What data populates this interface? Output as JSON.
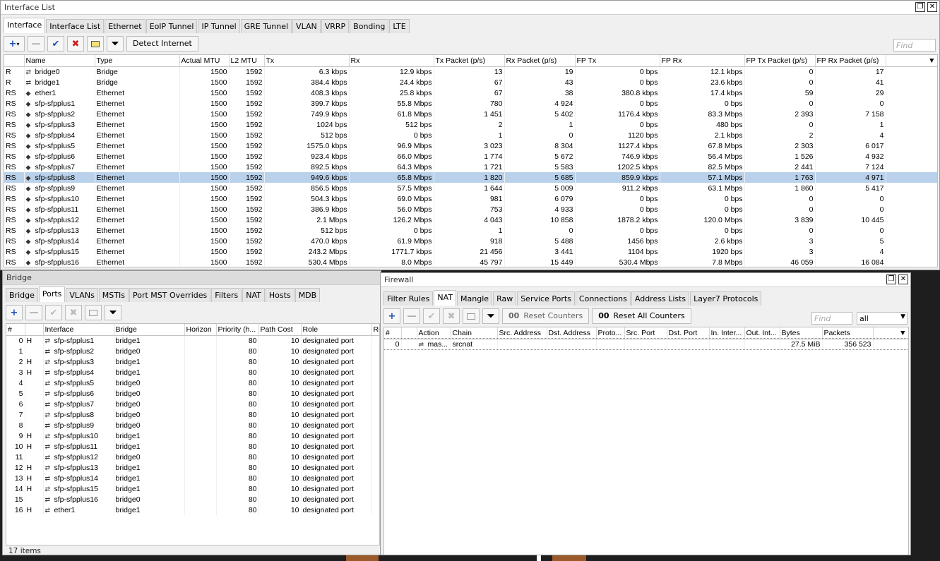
{
  "iface": {
    "title": "Interface List",
    "tabs": [
      "Interface",
      "Interface List",
      "Ethernet",
      "EoIP Tunnel",
      "IP Tunnel",
      "GRE Tunnel",
      "VLAN",
      "VRRP",
      "Bonding",
      "LTE"
    ],
    "detect_label": "Detect Internet",
    "find_placeholder": "Find",
    "columns": [
      "Name",
      "Type",
      "Actual MTU",
      "L2 MTU",
      "Tx",
      "Rx",
      "Tx Packet (p/s)",
      "Rx Packet (p/s)",
      "FP Tx",
      "FP Rx",
      "FP Tx Packet (p/s)",
      "FP Rx Packet (p/s)"
    ],
    "rows": [
      [
        "R",
        "bridge0",
        "Bridge",
        "1500",
        "1592",
        "6.3 kbps",
        "12.9 kbps",
        "13",
        "19",
        "0 bps",
        "12.1 kbps",
        "0",
        "17"
      ],
      [
        "R",
        "bridge1",
        "Bridge",
        "1500",
        "1592",
        "384.4 kbps",
        "24.4 kbps",
        "67",
        "43",
        "0 bps",
        "23.6 kbps",
        "0",
        "41"
      ],
      [
        "RS",
        "ether1",
        "Ethernet",
        "1500",
        "1592",
        "408.3 kbps",
        "25.8 kbps",
        "67",
        "38",
        "380.8 kbps",
        "17.4 kbps",
        "59",
        "29"
      ],
      [
        "RS",
        "sfp-sfpplus1",
        "Ethernet",
        "1500",
        "1592",
        "399.7 kbps",
        "55.8 Mbps",
        "780",
        "4 924",
        "0 bps",
        "0 bps",
        "0",
        "0"
      ],
      [
        "RS",
        "sfp-sfpplus2",
        "Ethernet",
        "1500",
        "1592",
        "749.9 kbps",
        "61.8 Mbps",
        "1 451",
        "5 402",
        "1176.4 kbps",
        "83.3 Mbps",
        "2 393",
        "7 158"
      ],
      [
        "RS",
        "sfp-sfpplus3",
        "Ethernet",
        "1500",
        "1592",
        "1024 bps",
        "512 bps",
        "2",
        "1",
        "0 bps",
        "480 bps",
        "0",
        "1"
      ],
      [
        "RS",
        "sfp-sfpplus4",
        "Ethernet",
        "1500",
        "1592",
        "512 bps",
        "0 bps",
        "1",
        "0",
        "1120 bps",
        "2.1 kbps",
        "2",
        "4"
      ],
      [
        "RS",
        "sfp-sfpplus5",
        "Ethernet",
        "1500",
        "1592",
        "1575.0 kbps",
        "96.9 Mbps",
        "3 023",
        "8 304",
        "1127.4 kbps",
        "67.8 Mbps",
        "2 303",
        "6 017"
      ],
      [
        "RS",
        "sfp-sfpplus6",
        "Ethernet",
        "1500",
        "1592",
        "923.4 kbps",
        "66.0 Mbps",
        "1 774",
        "5 672",
        "746.9 kbps",
        "56.4 Mbps",
        "1 526",
        "4 932"
      ],
      [
        "RS",
        "sfp-sfpplus7",
        "Ethernet",
        "1500",
        "1592",
        "892.5 kbps",
        "64.3 Mbps",
        "1 721",
        "5 583",
        "1202.5 kbps",
        "82.5 Mbps",
        "2 441",
        "7 124"
      ],
      [
        "RS",
        "sfp-sfpplus8",
        "Ethernet",
        "1500",
        "1592",
        "949.6 kbps",
        "65.8 Mbps",
        "1 820",
        "5 685",
        "859.9 kbps",
        "57.1 Mbps",
        "1 763",
        "4 971"
      ],
      [
        "RS",
        "sfp-sfpplus9",
        "Ethernet",
        "1500",
        "1592",
        "856.5 kbps",
        "57.5 Mbps",
        "1 644",
        "5 009",
        "911.2 kbps",
        "63.1 Mbps",
        "1 860",
        "5 417"
      ],
      [
        "RS",
        "sfp-sfpplus10",
        "Ethernet",
        "1500",
        "1592",
        "504.3 kbps",
        "69.0 Mbps",
        "981",
        "6 079",
        "0 bps",
        "0 bps",
        "0",
        "0"
      ],
      [
        "RS",
        "sfp-sfpplus11",
        "Ethernet",
        "1500",
        "1592",
        "386.9 kbps",
        "56.0 Mbps",
        "753",
        "4 933",
        "0 bps",
        "0 bps",
        "0",
        "0"
      ],
      [
        "RS",
        "sfp-sfpplus12",
        "Ethernet",
        "1500",
        "1592",
        "2.1 Mbps",
        "126.2 Mbps",
        "4 043",
        "10 858",
        "1878.2 kbps",
        "120.0 Mbps",
        "3 839",
        "10 445"
      ],
      [
        "RS",
        "sfp-sfpplus13",
        "Ethernet",
        "1500",
        "1592",
        "512 bps",
        "0 bps",
        "1",
        "0",
        "0 bps",
        "0 bps",
        "0",
        "0"
      ],
      [
        "RS",
        "sfp-sfpplus14",
        "Ethernet",
        "1500",
        "1592",
        "470.0 kbps",
        "61.9 Mbps",
        "918",
        "5 488",
        "1456 bps",
        "2.6 kbps",
        "3",
        "5"
      ],
      [
        "RS",
        "sfp-sfpplus15",
        "Ethernet",
        "1500",
        "1592",
        "243.2 Mbps",
        "1771.7 kbps",
        "21 456",
        "3 441",
        "1104 bps",
        "1920 bps",
        "3",
        "4"
      ],
      [
        "RS",
        "sfp-sfpplus16",
        "Ethernet",
        "1500",
        "1592",
        "530.4 Mbps",
        "8.0 Mbps",
        "45 797",
        "15 449",
        "530.4 Mbps",
        "7.8 Mbps",
        "46 059",
        "16 084"
      ]
    ],
    "selected_row": 10
  },
  "bridge": {
    "title": "Bridge",
    "tabs": [
      "Bridge",
      "Ports",
      "VLANs",
      "MSTIs",
      "Port MST Overrides",
      "Filters",
      "NAT",
      "Hosts",
      "MDB"
    ],
    "columns": [
      "#",
      "Interface",
      "Bridge",
      "Horizon",
      "Priority (h...",
      "Path Cost",
      "Role",
      "Ro"
    ],
    "rows": [
      [
        "0",
        "H",
        "sfp-sfpplus1",
        "bridge1",
        "",
        "80",
        "10",
        "designated port"
      ],
      [
        "1",
        "",
        "sfp-sfpplus2",
        "bridge0",
        "",
        "80",
        "10",
        "designated port"
      ],
      [
        "2",
        "H",
        "sfp-sfpplus3",
        "bridge1",
        "",
        "80",
        "10",
        "designated port"
      ],
      [
        "3",
        "H",
        "sfp-sfpplus4",
        "bridge1",
        "",
        "80",
        "10",
        "designated port"
      ],
      [
        "4",
        "",
        "sfp-sfpplus5",
        "bridge0",
        "",
        "80",
        "10",
        "designated port"
      ],
      [
        "5",
        "",
        "sfp-sfpplus6",
        "bridge0",
        "",
        "80",
        "10",
        "designated port"
      ],
      [
        "6",
        "",
        "sfp-sfpplus7",
        "bridge0",
        "",
        "80",
        "10",
        "designated port"
      ],
      [
        "7",
        "",
        "sfp-sfpplus8",
        "bridge0",
        "",
        "80",
        "10",
        "designated port"
      ],
      [
        "8",
        "",
        "sfp-sfpplus9",
        "bridge0",
        "",
        "80",
        "10",
        "designated port"
      ],
      [
        "9",
        "H",
        "sfp-sfpplus10",
        "bridge1",
        "",
        "80",
        "10",
        "designated port"
      ],
      [
        "10",
        "H",
        "sfp-sfpplus11",
        "bridge1",
        "",
        "80",
        "10",
        "designated port"
      ],
      [
        "11",
        "",
        "sfp-sfpplus12",
        "bridge0",
        "",
        "80",
        "10",
        "designated port"
      ],
      [
        "12",
        "H",
        "sfp-sfpplus13",
        "bridge1",
        "",
        "80",
        "10",
        "designated port"
      ],
      [
        "13",
        "H",
        "sfp-sfpplus14",
        "bridge1",
        "",
        "80",
        "10",
        "designated port"
      ],
      [
        "14",
        "H",
        "sfp-sfpplus15",
        "bridge1",
        "",
        "80",
        "10",
        "designated port"
      ],
      [
        "15",
        "",
        "sfp-sfpplus16",
        "bridge0",
        "",
        "80",
        "10",
        "designated port"
      ],
      [
        "16",
        "H",
        "ether1",
        "bridge1",
        "",
        "80",
        "10",
        "designated port"
      ]
    ],
    "status": "17 items"
  },
  "firewall": {
    "title": "Firewall",
    "tabs": [
      "Filter Rules",
      "NAT",
      "Mangle",
      "Raw",
      "Service Ports",
      "Connections",
      "Address Lists",
      "Layer7 Protocols"
    ],
    "reset_counters": "Reset Counters",
    "reset_all_counters": "Reset All Counters",
    "counter_icon": "00",
    "find_placeholder": "Find",
    "filter_value": "all",
    "columns": [
      "#",
      "Action",
      "Chain",
      "Src. Address",
      "Dst. Address",
      "Proto...",
      "Src. Port",
      "Dst. Port",
      "In. Inter...",
      "Out. Int...",
      "Bytes",
      "Packets"
    ],
    "rows": [
      [
        "0",
        "mas...",
        "srcnat",
        "",
        "",
        "",
        "",
        "",
        "",
        "",
        "27.5 MiB",
        "356 523"
      ]
    ]
  }
}
